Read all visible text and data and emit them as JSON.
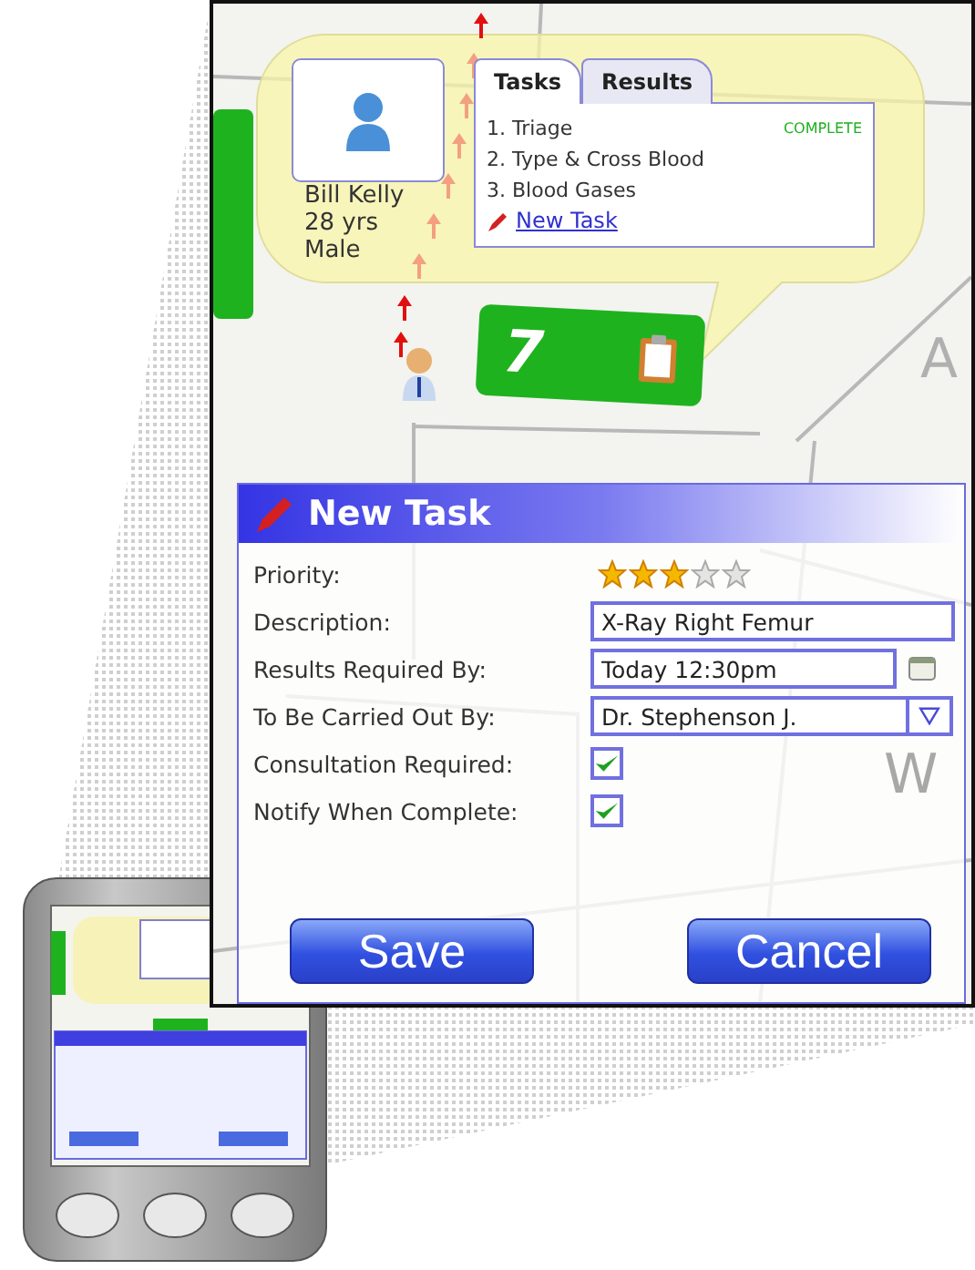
{
  "patient": {
    "name": "Bill Kelly",
    "age": "28 yrs",
    "sex": "Male"
  },
  "tabs": [
    {
      "label": "Tasks",
      "selected": true
    },
    {
      "label": "Results",
      "selected": false
    }
  ],
  "tasks": [
    {
      "label": "1. Triage",
      "status": "COMPLETE"
    },
    {
      "label": "2. Type & Cross Blood"
    },
    {
      "label": "3. Blood Gases"
    }
  ],
  "new_task_link": "New Task",
  "room": {
    "number": "7"
  },
  "map_labels": [
    "A",
    "W"
  ],
  "dialog": {
    "title": "New Task",
    "fields": [
      {
        "kind": "stars",
        "label": "Priority:",
        "stars": 3
      },
      {
        "kind": "text",
        "label": "Description:",
        "value": "X-Ray Right Femur"
      },
      {
        "kind": "date",
        "label": "Results Required By:",
        "value": "Today 12:30pm"
      },
      {
        "kind": "select",
        "label": "To Be Carried Out By:",
        "value": "Dr. Stephenson J."
      },
      {
        "kind": "checkbox",
        "label": "Consultation Required:",
        "checked": true
      },
      {
        "kind": "checkbox",
        "label": "Notify When Complete:",
        "checked": true
      }
    ],
    "buttons": [
      {
        "label": "Save"
      },
      {
        "label": "Cancel"
      }
    ]
  }
}
